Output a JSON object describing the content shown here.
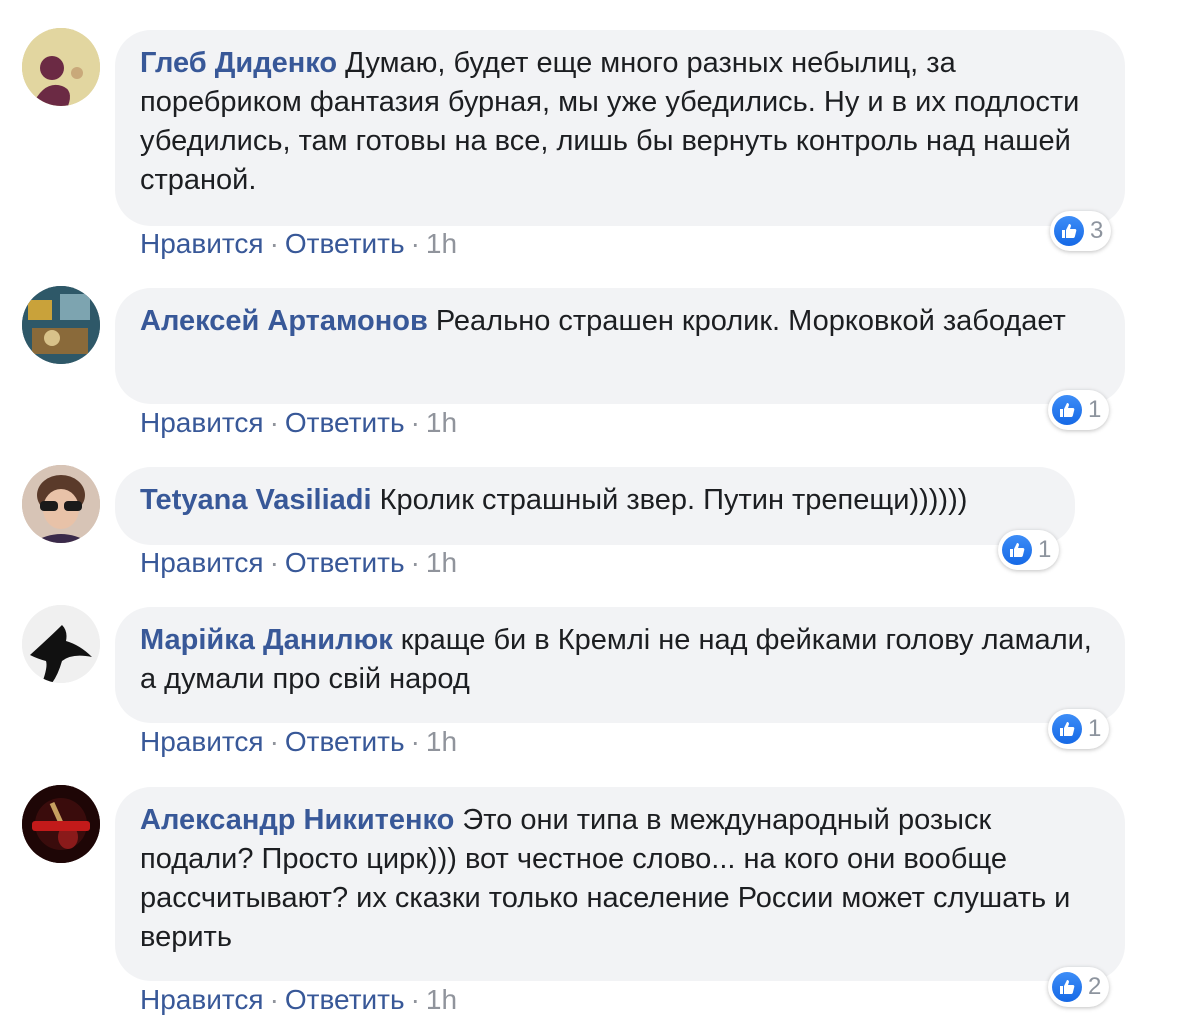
{
  "ui": {
    "like": "Нравится",
    "reply": "Ответить",
    "sep": "·"
  },
  "comments": [
    {
      "author": "Глеб Диденко",
      "text": "Думаю, будет еще много разных небылиц, за поребриком фантазия бурная, мы уже убедились. Ну и в их подлости убедились, там готовы на все, лишь бы вернуть контроль над нашей страной.",
      "time": "1h",
      "reactions": "3"
    },
    {
      "author": "Алексей Артамонов",
      "text": "Реально страшен кролик. Морковкой забодает",
      "time": "1h",
      "reactions": "1"
    },
    {
      "author": "Tetyana Vasiliadi",
      "text": "Кролик страшный звер. Путин трепещи))))))",
      "time": "1h",
      "reactions": "1"
    },
    {
      "author": "Марійка Данилюк",
      "text": "краще би в Кремлі не над фейками голову ламали, а думали про свій народ",
      "time": "1h",
      "reactions": "1"
    },
    {
      "author": "Александр Никитенко",
      "text": "Это они типа в международный розыск подали? Просто цирк))) вот честное слово... на кого они вообще рассчитывают? их сказки только население России может слушать и верить",
      "time": "1h",
      "reactions": "2"
    }
  ]
}
